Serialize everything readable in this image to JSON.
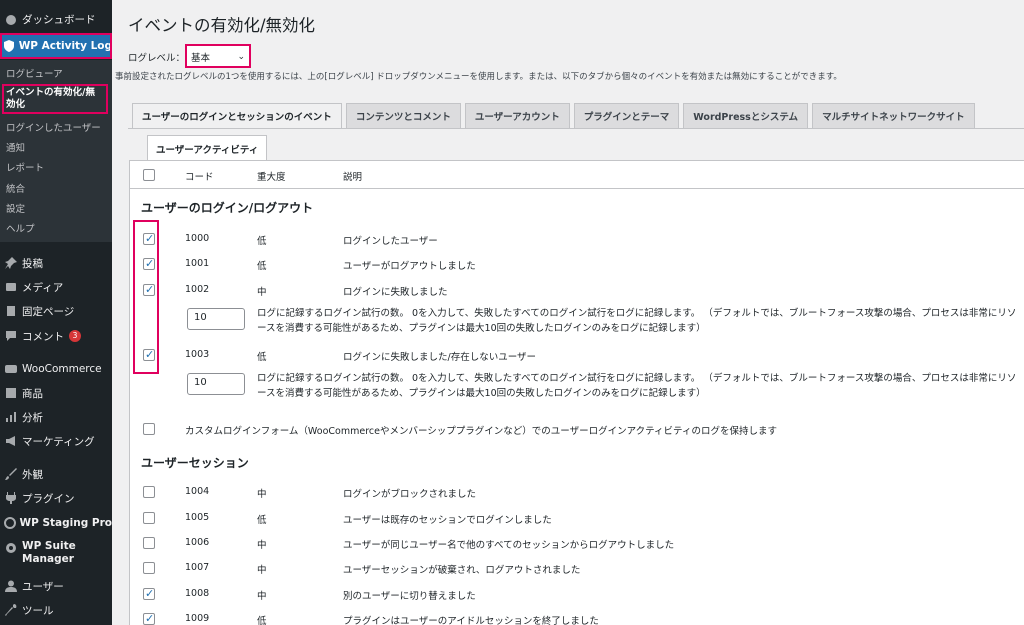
{
  "sidebar": {
    "dashboard": "ダッシュボード",
    "wsal": "WP Activity Log",
    "sub": {
      "viewer": "ログビューア",
      "enable_disable": "イベントの有効化/無効化",
      "logged_in_users": "ログインしたユーザー",
      "notifications": "通知",
      "reports": "レポート",
      "integrations": "統合",
      "settings": "設定",
      "help": "ヘルプ"
    },
    "posts": "投稿",
    "media": "メディア",
    "pages": "固定ページ",
    "comments": "コメント",
    "comments_badge": "3",
    "woocommerce": "WooCommerce",
    "products": "商品",
    "analytics": "分析",
    "marketing": "マーケティング",
    "appearance": "外観",
    "plugins": "プラグイン",
    "wp_staging": "WP Staging Pro",
    "wp_suite": "WP Suite Manager",
    "users": "ユーザー",
    "tools": "ツール"
  },
  "page": {
    "title": "イベントの有効化/無効化",
    "loglevel_label": "ログレベル：",
    "loglevel_value": "基本",
    "description": "事前設定されたログレベルの1つを使用するには、上の[ログレベル] ドロップダウンメニューを使用します。または、以下のタブから個々のイベントを有効または無効にすることができます。"
  },
  "tabs": [
    "ユーザーのログインとセッションのイベント",
    "コンテンツとコメント",
    "ユーザーアカウント",
    "プラグインとテーマ",
    "WordPressとシステム",
    "マルチサイトネットワークサイト"
  ],
  "subtab": "ユーザーアクティビティ",
  "table_header": {
    "code": "コード",
    "severity": "重大度",
    "description": "説明"
  },
  "section_login": "ユーザーのログイン/ログアウト",
  "section_session": "ユーザーセッション",
  "events_login": [
    {
      "code": "1000",
      "severity": "低",
      "desc": "ログインしたユーザー",
      "checked": true
    },
    {
      "code": "1001",
      "severity": "低",
      "desc": "ユーザーがログアウトしました",
      "checked": true
    },
    {
      "code": "1002",
      "severity": "中",
      "desc": "ログインに失敗しました",
      "checked": true
    },
    {
      "code": "1003",
      "severity": "低",
      "desc": "ログインに失敗しました/存在しないユーザー",
      "checked": true
    }
  ],
  "attempts": {
    "value": "10",
    "line1": "ログに記録するログイン試行の数。 0を入力して、失敗したすべてのログイン試行をログに記録します。 （デフォルトでは、ブルートフォース攻撃の場合、プロセスは非常にリソ",
    "line2": "ースを消費する可能性があるため、プラグインは最大10回の失敗したログインのみをログに記録します）"
  },
  "custom_login": "カスタムログインフォーム（WooCommerceやメンバーシッププラグインなど）でのユーザーログインアクティビティのログを保持します",
  "events_session": [
    {
      "code": "1004",
      "severity": "中",
      "desc": "ログインがブロックされました",
      "checked": false
    },
    {
      "code": "1005",
      "severity": "低",
      "desc": "ユーザーは既存のセッションでログインしました",
      "checked": false
    },
    {
      "code": "1006",
      "severity": "中",
      "desc": "ユーザーが同じユーザー名で他のすべてのセッションからログアウトしました",
      "checked": false
    },
    {
      "code": "1007",
      "severity": "中",
      "desc": "ユーザーセッションが破棄され、ログアウトされました",
      "checked": false
    },
    {
      "code": "1008",
      "severity": "中",
      "desc": "別のユーザーに切り替えました",
      "checked": true
    },
    {
      "code": "1009",
      "severity": "低",
      "desc": "プラグインはユーザーのアイドルセッションを終了しました",
      "checked": true
    }
  ],
  "colors": {
    "accent": "#2271b1",
    "highlight": "#e0005e",
    "sidebar_bg": "#1d2327"
  }
}
